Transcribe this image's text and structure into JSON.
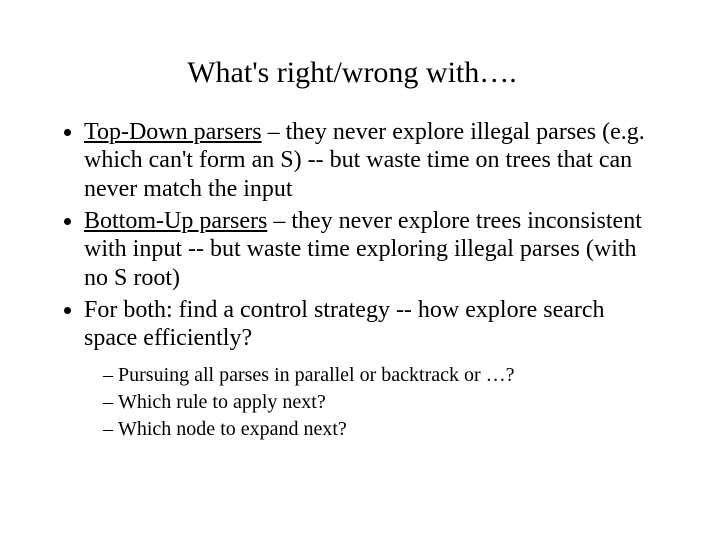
{
  "title": "What's right/wrong with….",
  "bullets": {
    "b1_lead": "Top-Down parsers",
    "b1_rest": " – they never explore illegal parses (e.g. which can't form an S) -- but waste time on trees that can never match the input",
    "b2_lead": "Bottom-Up parsers",
    "b2_rest": " – they never explore trees inconsistent with input -- but waste time exploring illegal parses (with no S root)",
    "b3": "For both: find a control strategy -- how explore search space efficiently?"
  },
  "sub": {
    "s1": "Pursuing all parses in parallel or backtrack or …?",
    "s2": "Which rule to apply next?",
    "s3": "Which node to expand next?"
  }
}
